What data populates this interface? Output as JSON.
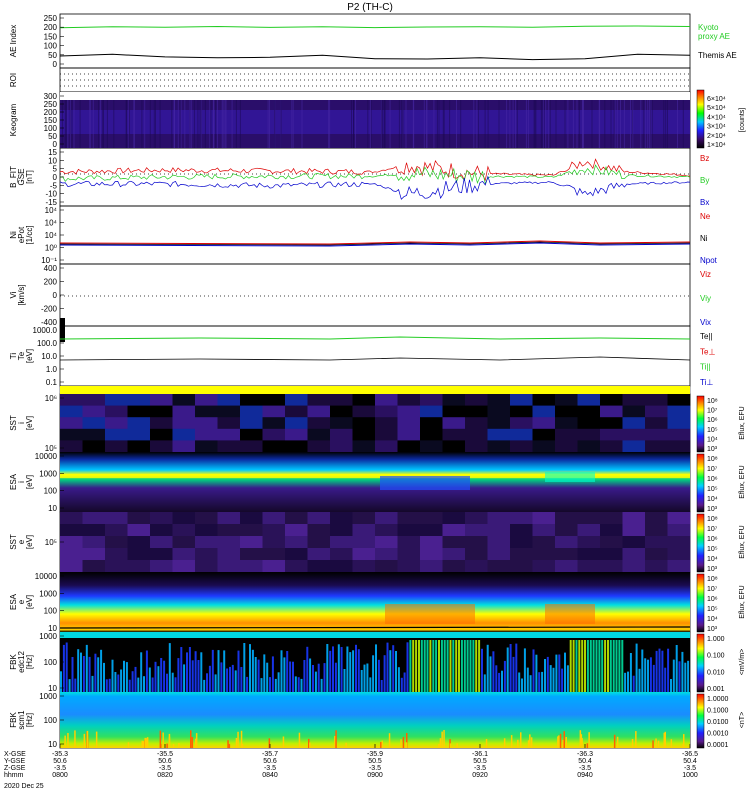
{
  "title": "P2 (TH-C)",
  "footer": {
    "row_labels": [
      "X-GSE",
      "Y-GSE",
      "Z-GSE",
      "hhmm",
      "2020 Dec 25"
    ],
    "columns": [
      {
        "x": "-35.3",
        "y": "50.6",
        "z": "-3.5",
        "t": "0800"
      },
      {
        "x": "-35.5",
        "y": "50.6",
        "z": "-3.5",
        "t": "0820"
      },
      {
        "x": "-35.7",
        "y": "50.6",
        "z": "-3.5",
        "t": "0840"
      },
      {
        "x": "-35.9",
        "y": "50.5",
        "z": "-3.5",
        "t": "0900"
      },
      {
        "x": "-36.1",
        "y": "50.5",
        "z": "-3.5",
        "t": "0920"
      },
      {
        "x": "-36.3",
        "y": "50.4",
        "z": "-3.5",
        "t": "0940"
      },
      {
        "x": "-36.5",
        "y": "50.4",
        "z": "-3.5",
        "t": "1000"
      }
    ]
  },
  "chart_data": [
    {
      "type": "line",
      "panel": "ae",
      "ylabel": "AE Index",
      "yticks": [
        "250",
        "200",
        "150",
        "100",
        "50",
        "0"
      ],
      "ylim": [
        0,
        260
      ],
      "series": [
        {
          "name": "Kyoto\nproxy AE",
          "color": "#22cc22",
          "x": [
            0,
            10,
            20,
            30,
            40,
            50,
            60,
            70,
            80,
            90,
            100,
            110,
            120
          ],
          "values": [
            205,
            210,
            208,
            212,
            207,
            210,
            206,
            209,
            211,
            208,
            213,
            215,
            212
          ]
        },
        {
          "name": "Themis AE",
          "color": "#000000",
          "x": [
            0,
            10,
            20,
            30,
            40,
            50,
            60,
            70,
            80,
            90,
            100,
            110,
            120
          ],
          "values": [
            45,
            55,
            40,
            35,
            38,
            50,
            30,
            28,
            35,
            25,
            30,
            55,
            50
          ]
        }
      ]
    },
    {
      "type": "heatmap",
      "panel": "roi",
      "ylabel": "ROI"
    },
    {
      "type": "heatmap",
      "panel": "keogram",
      "ylabel": "Keogram",
      "yticks": [
        "300",
        "250",
        "200",
        "150",
        "100",
        "50",
        "0"
      ],
      "colorbar": {
        "label": "[counts]",
        "ticks": [
          "6×10⁴",
          "5×10⁴",
          "4×10⁴",
          "3×10⁴",
          "2×10⁴",
          "1×10⁴"
        ]
      }
    },
    {
      "type": "line",
      "panel": "bfit",
      "ylabel": "B_FIT\nGSE\n[nT]",
      "yticks": [
        "15",
        "10",
        "5",
        "0",
        "-5",
        "-10",
        "-15"
      ],
      "ylim": [
        -15,
        15
      ],
      "series": [
        {
          "name": "Bz",
          "color": "#dd0000",
          "x": [
            0,
            20,
            40,
            60,
            66,
            80,
            94,
            100,
            108,
            120
          ],
          "values": [
            3,
            4,
            3.5,
            3,
            7,
            2,
            1,
            9,
            3,
            1
          ]
        },
        {
          "name": "By",
          "color": "#22cc22",
          "x": [
            0,
            20,
            40,
            60,
            66,
            80,
            94,
            100,
            108,
            120
          ],
          "values": [
            -1,
            0,
            0.5,
            0.5,
            2,
            0.5,
            0,
            5,
            1,
            0
          ]
        },
        {
          "name": "Bx",
          "color": "#0000cc",
          "x": [
            0,
            20,
            40,
            60,
            66,
            80,
            94,
            100,
            108,
            120
          ],
          "values": [
            -4,
            -4,
            -5,
            -4,
            -10,
            -4,
            -3,
            -10,
            -4,
            -3
          ]
        }
      ]
    },
    {
      "type": "line",
      "panel": "ni",
      "ylabel": "Ni\nePot\n[1/cc]",
      "yticks": [
        "10⁴",
        "10⁴",
        "10⁴",
        "10⁰",
        "10⁻¹"
      ],
      "series": [
        {
          "name": "Ne",
          "color": "#dd0000"
        },
        {
          "name": "Ni",
          "color": "#000000"
        },
        {
          "name": "Npot",
          "color": "#0000cc"
        }
      ]
    },
    {
      "type": "line",
      "panel": "vi",
      "ylabel": "Vi\n[km/s]",
      "yticks": [
        "400",
        "200",
        "0",
        "-200",
        "-400"
      ],
      "ylim": [
        -500,
        500
      ],
      "series": [
        {
          "name": "Viz",
          "color": "#dd0000"
        },
        {
          "name": "Viy",
          "color": "#22cc22"
        },
        {
          "name": "Vix",
          "color": "#0000cc"
        }
      ]
    },
    {
      "type": "line",
      "panel": "ti",
      "ylabel": "Ti\nTe\n[eV]",
      "yticks": [
        "1000.0",
        "100.0",
        "10.0",
        "1.0",
        "0.1"
      ],
      "series": [
        {
          "name": "Te||",
          "color": "#000000"
        },
        {
          "name": "Te⊥",
          "color": "#dd0000"
        },
        {
          "name": "Ti||",
          "color": "#22cc22"
        },
        {
          "name": "Ti⊥",
          "color": "#0000cc"
        }
      ]
    },
    {
      "type": "heatmap",
      "panel": "sst_i",
      "ylabel": "SST\ni\n[eV]",
      "yticks": [
        "10⁶",
        "10⁵"
      ],
      "colorbar": {
        "label": "Eflux, EFU",
        "ticks": [
          "10⁸",
          "10⁷",
          "10⁶",
          "10⁵",
          "10⁴",
          "10³"
        ]
      }
    },
    {
      "type": "heatmap",
      "panel": "esa_i",
      "ylabel": "ESA\ni\n[eV]",
      "yticks": [
        "10000",
        "1000",
        "100",
        "10"
      ],
      "colorbar": {
        "label": "Eflux, EFU",
        "ticks": [
          "10⁸",
          "10⁷",
          "10⁶",
          "10⁵",
          "10⁴",
          "10³"
        ]
      }
    },
    {
      "type": "heatmap",
      "panel": "sst_e",
      "ylabel": "SST\ne\n[eV]",
      "yticks": [
        "10⁵"
      ],
      "colorbar": {
        "label": "Eflux, EFU",
        "ticks": [
          "10⁸",
          "10⁷",
          "10⁶",
          "10⁵",
          "10⁴",
          "10³"
        ]
      }
    },
    {
      "type": "heatmap",
      "panel": "esa_e",
      "ylabel": "ESA\ne\n[eV]",
      "yticks": [
        "10000",
        "1000",
        "100",
        "10"
      ],
      "colorbar": {
        "label": "Eflux, EFU",
        "ticks": [
          "10⁸",
          "10⁷",
          "10⁶",
          "10⁵",
          "10⁴",
          "10³"
        ]
      }
    },
    {
      "type": "heatmap",
      "panel": "fbk_e",
      "ylabel": "FBK\nedc12\n[Hz]",
      "yticks": [
        "1000",
        "100",
        "10"
      ],
      "colorbar": {
        "label": "<mV/m>",
        "ticks": [
          "1.000",
          "0.100",
          "0.010",
          "0.001"
        ]
      }
    },
    {
      "type": "heatmap",
      "panel": "fbk_b",
      "ylabel": "FBK\nscm1\n[Hz]",
      "yticks": [
        "1000",
        "100",
        "10"
      ],
      "colorbar": {
        "label": "<nT>",
        "ticks": [
          "1.0000",
          "0.1000",
          "0.0100",
          "0.0010",
          "0.0001"
        ]
      }
    }
  ]
}
